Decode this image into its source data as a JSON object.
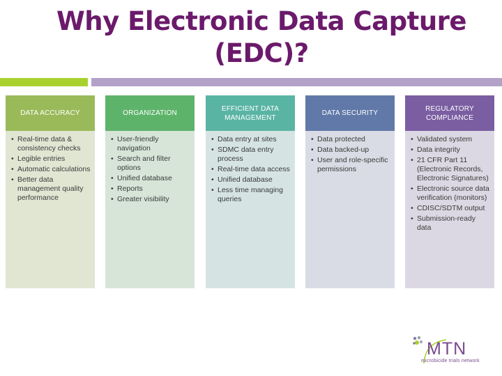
{
  "slide": {
    "title": "Why Electronic Data Capture (EDC)?",
    "columns": [
      {
        "heading": "DATA ACCURACY",
        "items": [
          "Real-time data & consistency checks",
          "Legible entries",
          "Automatic calculations",
          "Better data management quality performance"
        ]
      },
      {
        "heading": "ORGANIZATION",
        "items": [
          "User-friendly navigation",
          "Search and filter options",
          "Unified database",
          "Reports",
          "Greater visibility"
        ]
      },
      {
        "heading": "EFFICIENT DATA MANAGEMENT",
        "items": [
          "Data entry at sites",
          "SDMC data entry process",
          "Real-time data access",
          "Unified database",
          "Less time managing queries"
        ]
      },
      {
        "heading": "DATA SECURITY",
        "items": [
          "Data protected",
          "Data backed-up",
          "User and role-specific permissions"
        ]
      },
      {
        "heading": "REGULATORY COMPLIANCE",
        "items": [
          "Validated system",
          "Data integrity",
          "21 CFR Part 11 (Electronic Records, Electronic Signatures)",
          "Electronic source data verification (monitors)",
          "CDISC/SDTM output",
          "Submission-ready data"
        ]
      }
    ]
  },
  "logo": {
    "name": "MTN",
    "tagline": "microbicide trials network"
  },
  "colors": {
    "title": "#6b1a6b",
    "accent_green": "#a8d12e",
    "accent_purple": "#b3a2c8"
  }
}
